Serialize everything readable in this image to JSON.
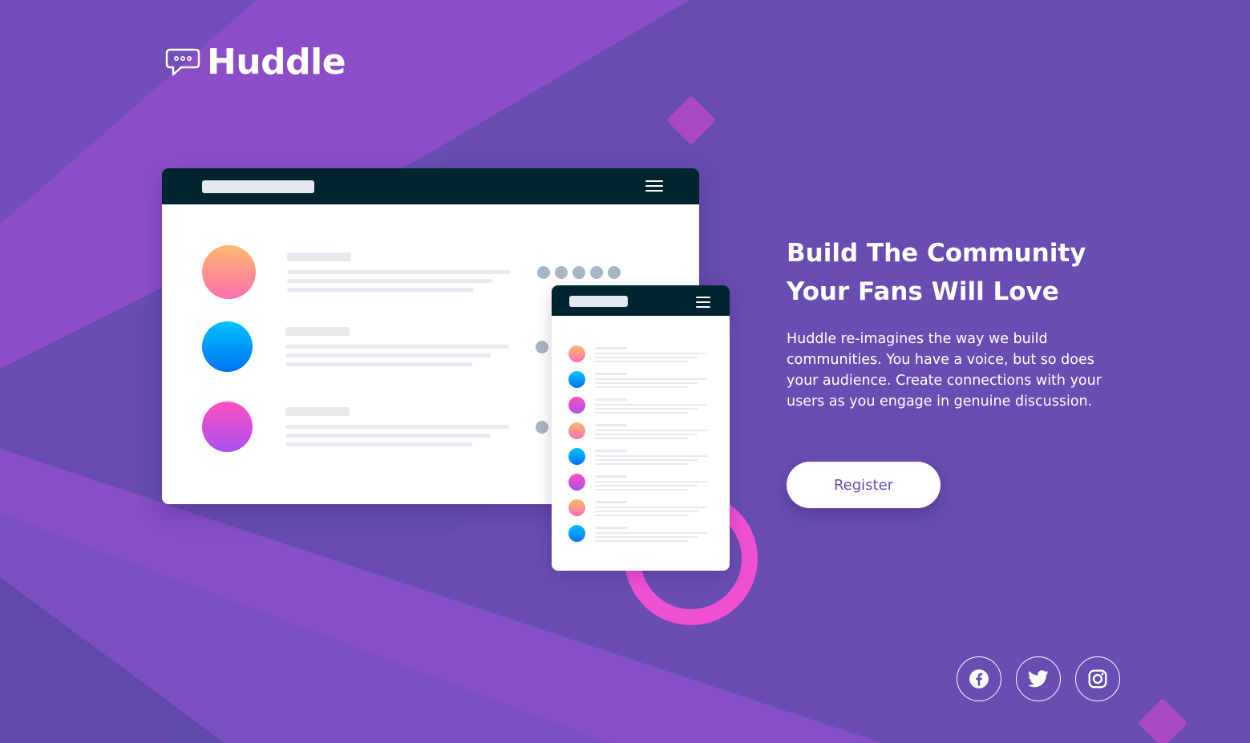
{
  "brand": {
    "name": "Huddle",
    "logo_icon": "chat-bubble-icon"
  },
  "hero": {
    "title_line1": "Build The Community",
    "title_line2": "Your Fans Will Love",
    "description": "Huddle re-imagines the way we build communities. You have a voice, but so does your audience. Create connections with your users as you engage in genuine discussion.",
    "register_label": "Register"
  },
  "social": [
    {
      "icon": "facebook-icon"
    },
    {
      "icon": "twitter-icon"
    },
    {
      "icon": "instagram-icon"
    }
  ],
  "colors": {
    "background": "#694db2",
    "accent_pink": "#f04fd0",
    "dark_bar": "#00252e",
    "white": "#ffffff"
  }
}
